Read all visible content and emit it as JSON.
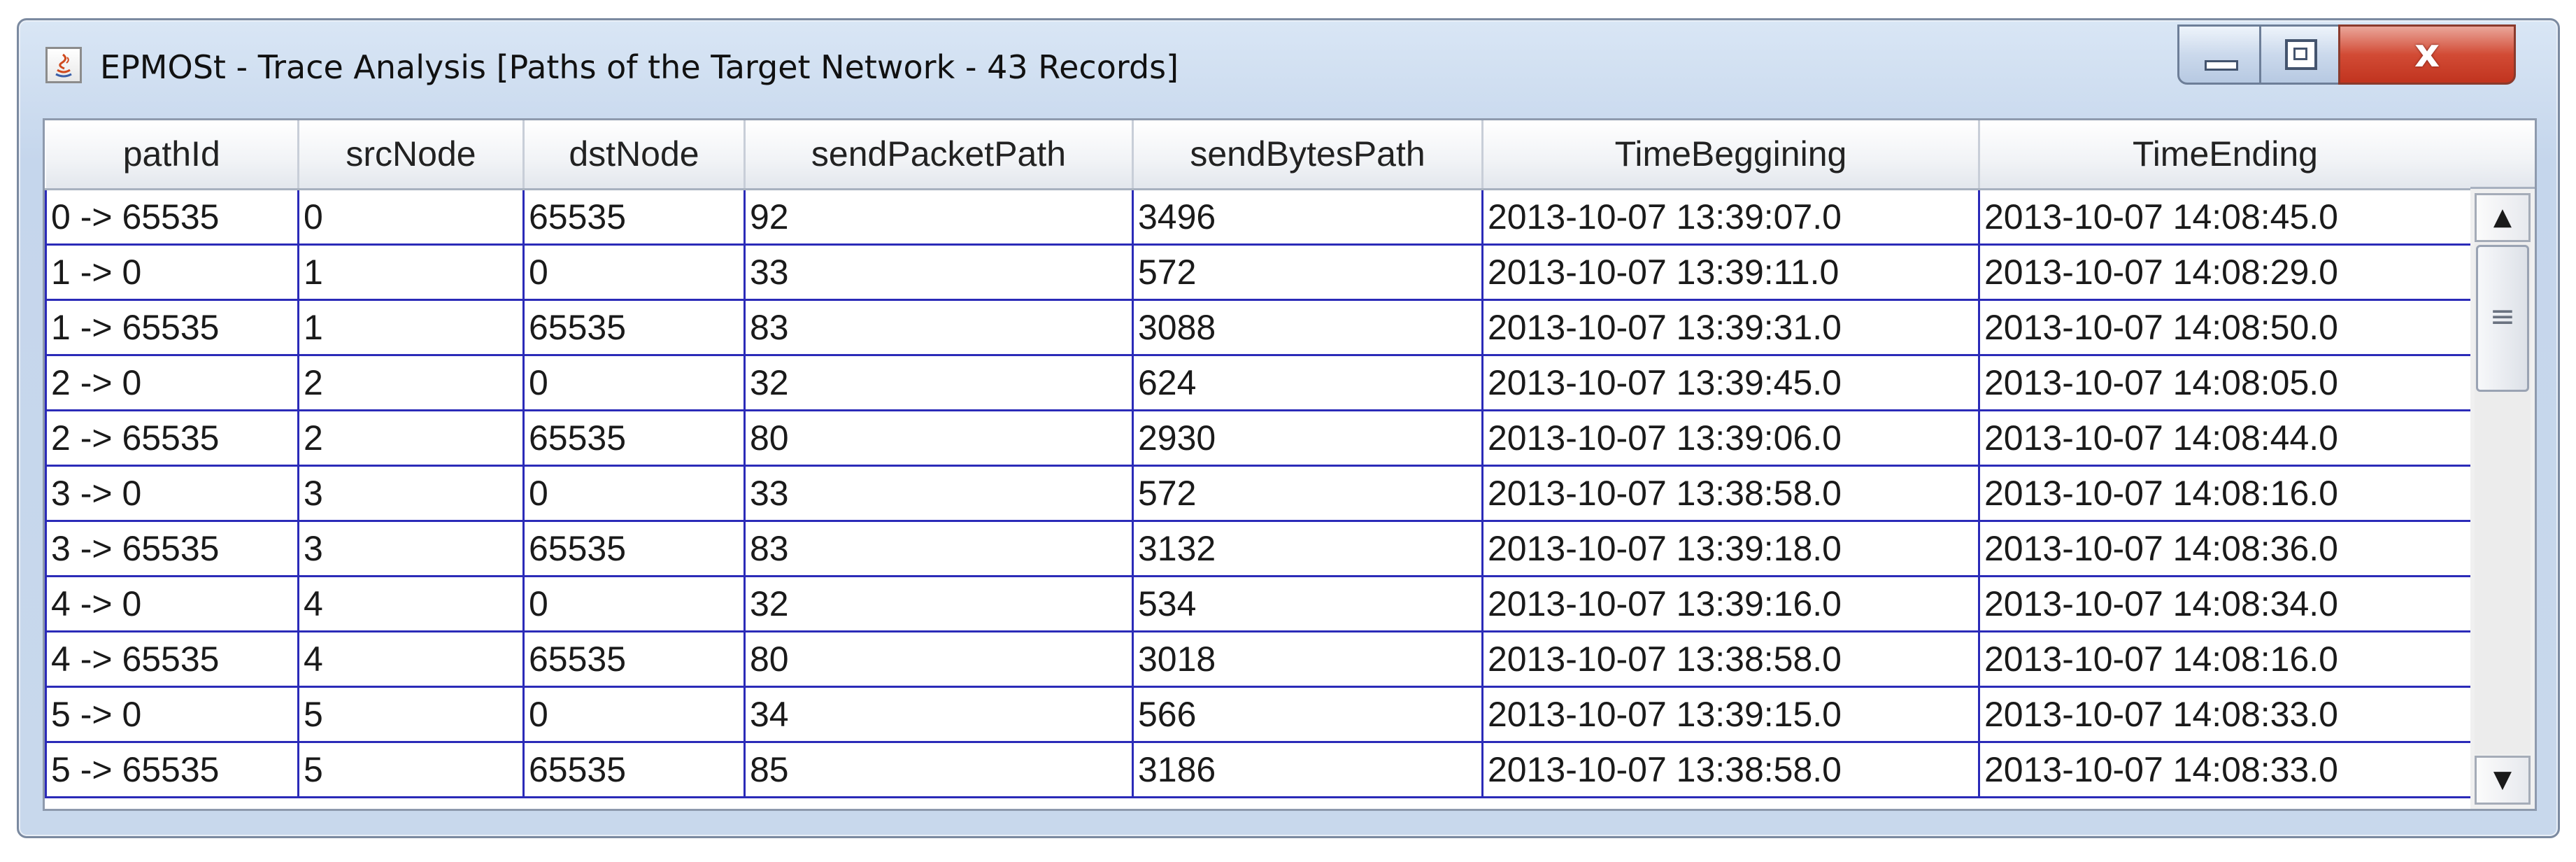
{
  "window": {
    "title": "EPMOSt - Trace Analysis [Paths of the Target Network - 43 Records]",
    "icon": "java-app-icon",
    "controls": {
      "minimize": "minimize-icon",
      "maximize": "maximize-icon",
      "close_label": "x"
    }
  },
  "table": {
    "columns": [
      "pathId",
      "srcNode",
      "dstNode",
      "sendPacketPath",
      "sendBytesPath",
      "TimeBeggining",
      "TimeEnding"
    ],
    "rows": [
      [
        "0 -> 65535",
        "0",
        "65535",
        "92",
        "3496",
        "2013-10-07 13:39:07.0",
        "2013-10-07 14:08:45.0"
      ],
      [
        "1 -> 0",
        "1",
        "0",
        "33",
        "572",
        "2013-10-07 13:39:11.0",
        "2013-10-07 14:08:29.0"
      ],
      [
        "1 -> 65535",
        "1",
        "65535",
        "83",
        "3088",
        "2013-10-07 13:39:31.0",
        "2013-10-07 14:08:50.0"
      ],
      [
        "2 -> 0",
        "2",
        "0",
        "32",
        "624",
        "2013-10-07 13:39:45.0",
        "2013-10-07 14:08:05.0"
      ],
      [
        "2 -> 65535",
        "2",
        "65535",
        "80",
        "2930",
        "2013-10-07 13:39:06.0",
        "2013-10-07 14:08:44.0"
      ],
      [
        "3 -> 0",
        "3",
        "0",
        "33",
        "572",
        "2013-10-07 13:38:58.0",
        "2013-10-07 14:08:16.0"
      ],
      [
        "3 -> 65535",
        "3",
        "65535",
        "83",
        "3132",
        "2013-10-07 13:39:18.0",
        "2013-10-07 14:08:36.0"
      ],
      [
        "4 -> 0",
        "4",
        "0",
        "32",
        "534",
        "2013-10-07 13:39:16.0",
        "2013-10-07 14:08:34.0"
      ],
      [
        "4 -> 65535",
        "4",
        "65535",
        "80",
        "3018",
        "2013-10-07 13:38:58.0",
        "2013-10-07 14:08:16.0"
      ],
      [
        "5 -> 0",
        "5",
        "0",
        "34",
        "566",
        "2013-10-07 13:39:15.0",
        "2013-10-07 14:08:33.0"
      ],
      [
        "5 -> 65535",
        "5",
        "65535",
        "85",
        "3186",
        "2013-10-07 13:38:58.0",
        "2013-10-07 14:08:33.0"
      ]
    ]
  },
  "scrollbar": {
    "up_icon": "scroll-up-arrow-icon",
    "down_icon": "scroll-down-arrow-icon",
    "thumb_icon": "scroll-thumb-grip-icon"
  },
  "colors": {
    "cell_border": "#2b2bb8",
    "close_button": "#c1341f"
  }
}
